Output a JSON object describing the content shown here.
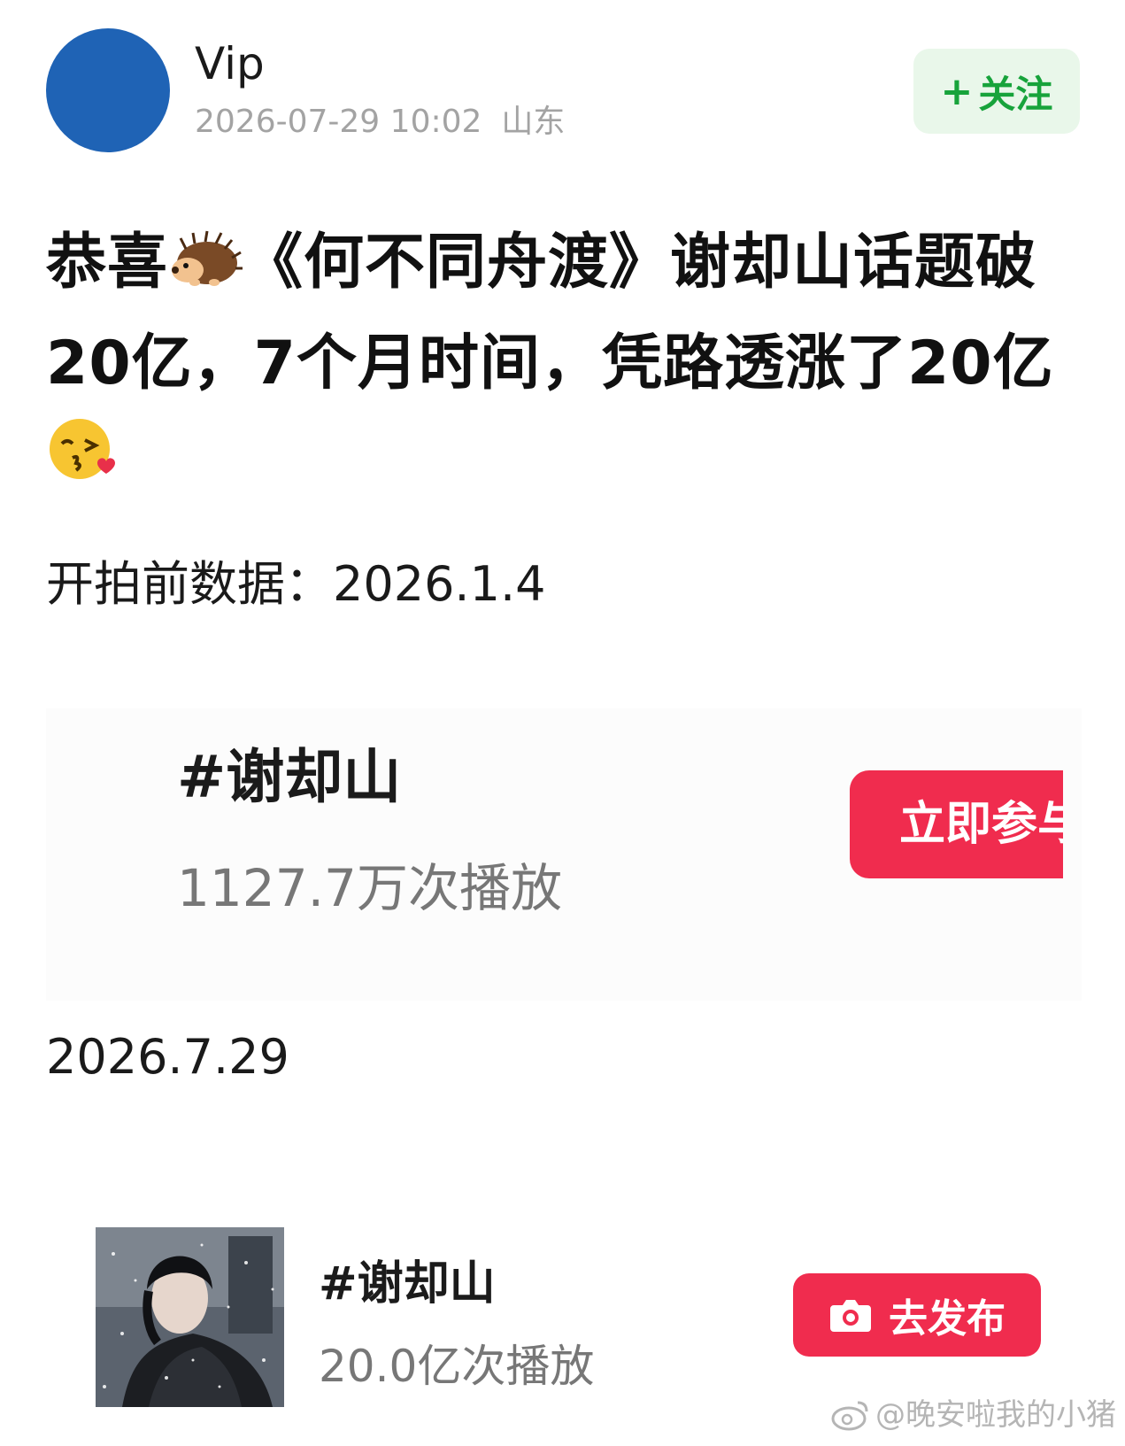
{
  "header": {
    "username": "Vip",
    "timestamp": "2026-07-29 10:02",
    "location": "山东",
    "follow_label": "关注",
    "follow_plus": "+"
  },
  "post": {
    "title_part1": "恭喜",
    "title_part2": "《何不同舟渡》谢却山话题破20亿，7个月时间，凭路透涨了20亿",
    "emoji_1": "hedgehog-icon",
    "emoji_2": "kissing-face-icon"
  },
  "before": {
    "label": "开拍前数据：2026.1.4",
    "topic": "#谢却山",
    "views": "1127.7万次播放",
    "join_label": "立即参与"
  },
  "after": {
    "label": "2026.7.29",
    "topic": "#谢却山",
    "views": "20.0亿次播放",
    "publish_label": "去发布"
  },
  "watermark": {
    "text": "@晚安啦我的小猪"
  },
  "colors": {
    "avatar": "#1f63b5",
    "follow_bg": "#e9f7ea",
    "follow_text": "#17a33b",
    "accent_red": "#f02c4e"
  }
}
